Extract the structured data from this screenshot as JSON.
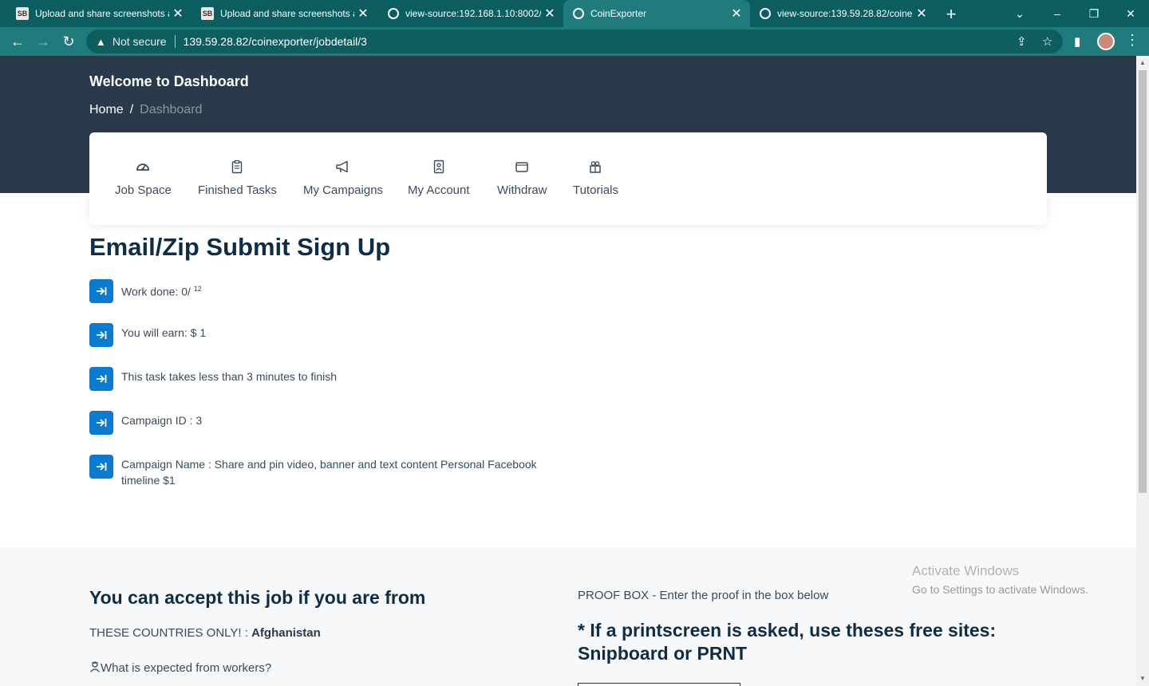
{
  "browser": {
    "tabs": [
      {
        "title": "Upload and share screenshots a",
        "favicon": "SB",
        "active": false
      },
      {
        "title": "Upload and share screenshots a",
        "favicon": "SB",
        "active": false
      },
      {
        "title": "view-source:192.168.1.10:8002/j",
        "favicon": "globe",
        "active": false
      },
      {
        "title": "CoinExporter",
        "favicon": "globe",
        "active": true
      },
      {
        "title": "view-source:139.59.28.82/coine",
        "favicon": "globe",
        "active": false
      }
    ],
    "security_label": "Not secure",
    "url": "139.59.28.82/coinexporter/jobdetail/3"
  },
  "header": {
    "title": "Welcome to Dashboard",
    "breadcrumb": {
      "home": "Home",
      "separator": "/",
      "current": "Dashboard"
    }
  },
  "menu": [
    {
      "label": "Job Space",
      "icon": "dashboard-gauge-icon"
    },
    {
      "label": "Finished Tasks",
      "icon": "clipboard-icon"
    },
    {
      "label": "My Campaigns",
      "icon": "megaphone-icon"
    },
    {
      "label": "My Account",
      "icon": "user-badge-icon"
    },
    {
      "label": "Withdraw",
      "icon": "wallet-icon"
    },
    {
      "label": "Tutorials",
      "icon": "box-icon"
    }
  ],
  "job": {
    "title": "Email/Zip Submit Sign Up",
    "work_done_label": "Work done: 0/",
    "work_total": "12",
    "earn": "You will earn: $ 1",
    "duration": "This task takes less than 3 minutes to finish",
    "campaign_id": "Campaign ID : 3",
    "campaign_name": "Campaign Name : Share and pin video, banner and text content Personal Facebook timeline $1"
  },
  "requirements": {
    "title": "You can accept this job if you are from",
    "countries_label": "THESE COUNTRIES ONLY! :",
    "countries_value": "Afghanistan",
    "expected": "What is expected from workers?"
  },
  "proof": {
    "label": "PROOF BOX - Enter the proof in the box below",
    "printscreen_note": "* If a printscreen is asked, use theses free sites: Snipboard or PRNT"
  },
  "watermark": {
    "line1": "Activate Windows",
    "line2": "Go to Settings to activate Windows."
  },
  "colors": {
    "chrome_dark": "#0b5d5f",
    "chrome_toolbar": "#1f7b7c",
    "hero_bg": "#2b3a4a",
    "accent_blue": "#0a7bd0",
    "title_navy": "#0f2d45"
  }
}
